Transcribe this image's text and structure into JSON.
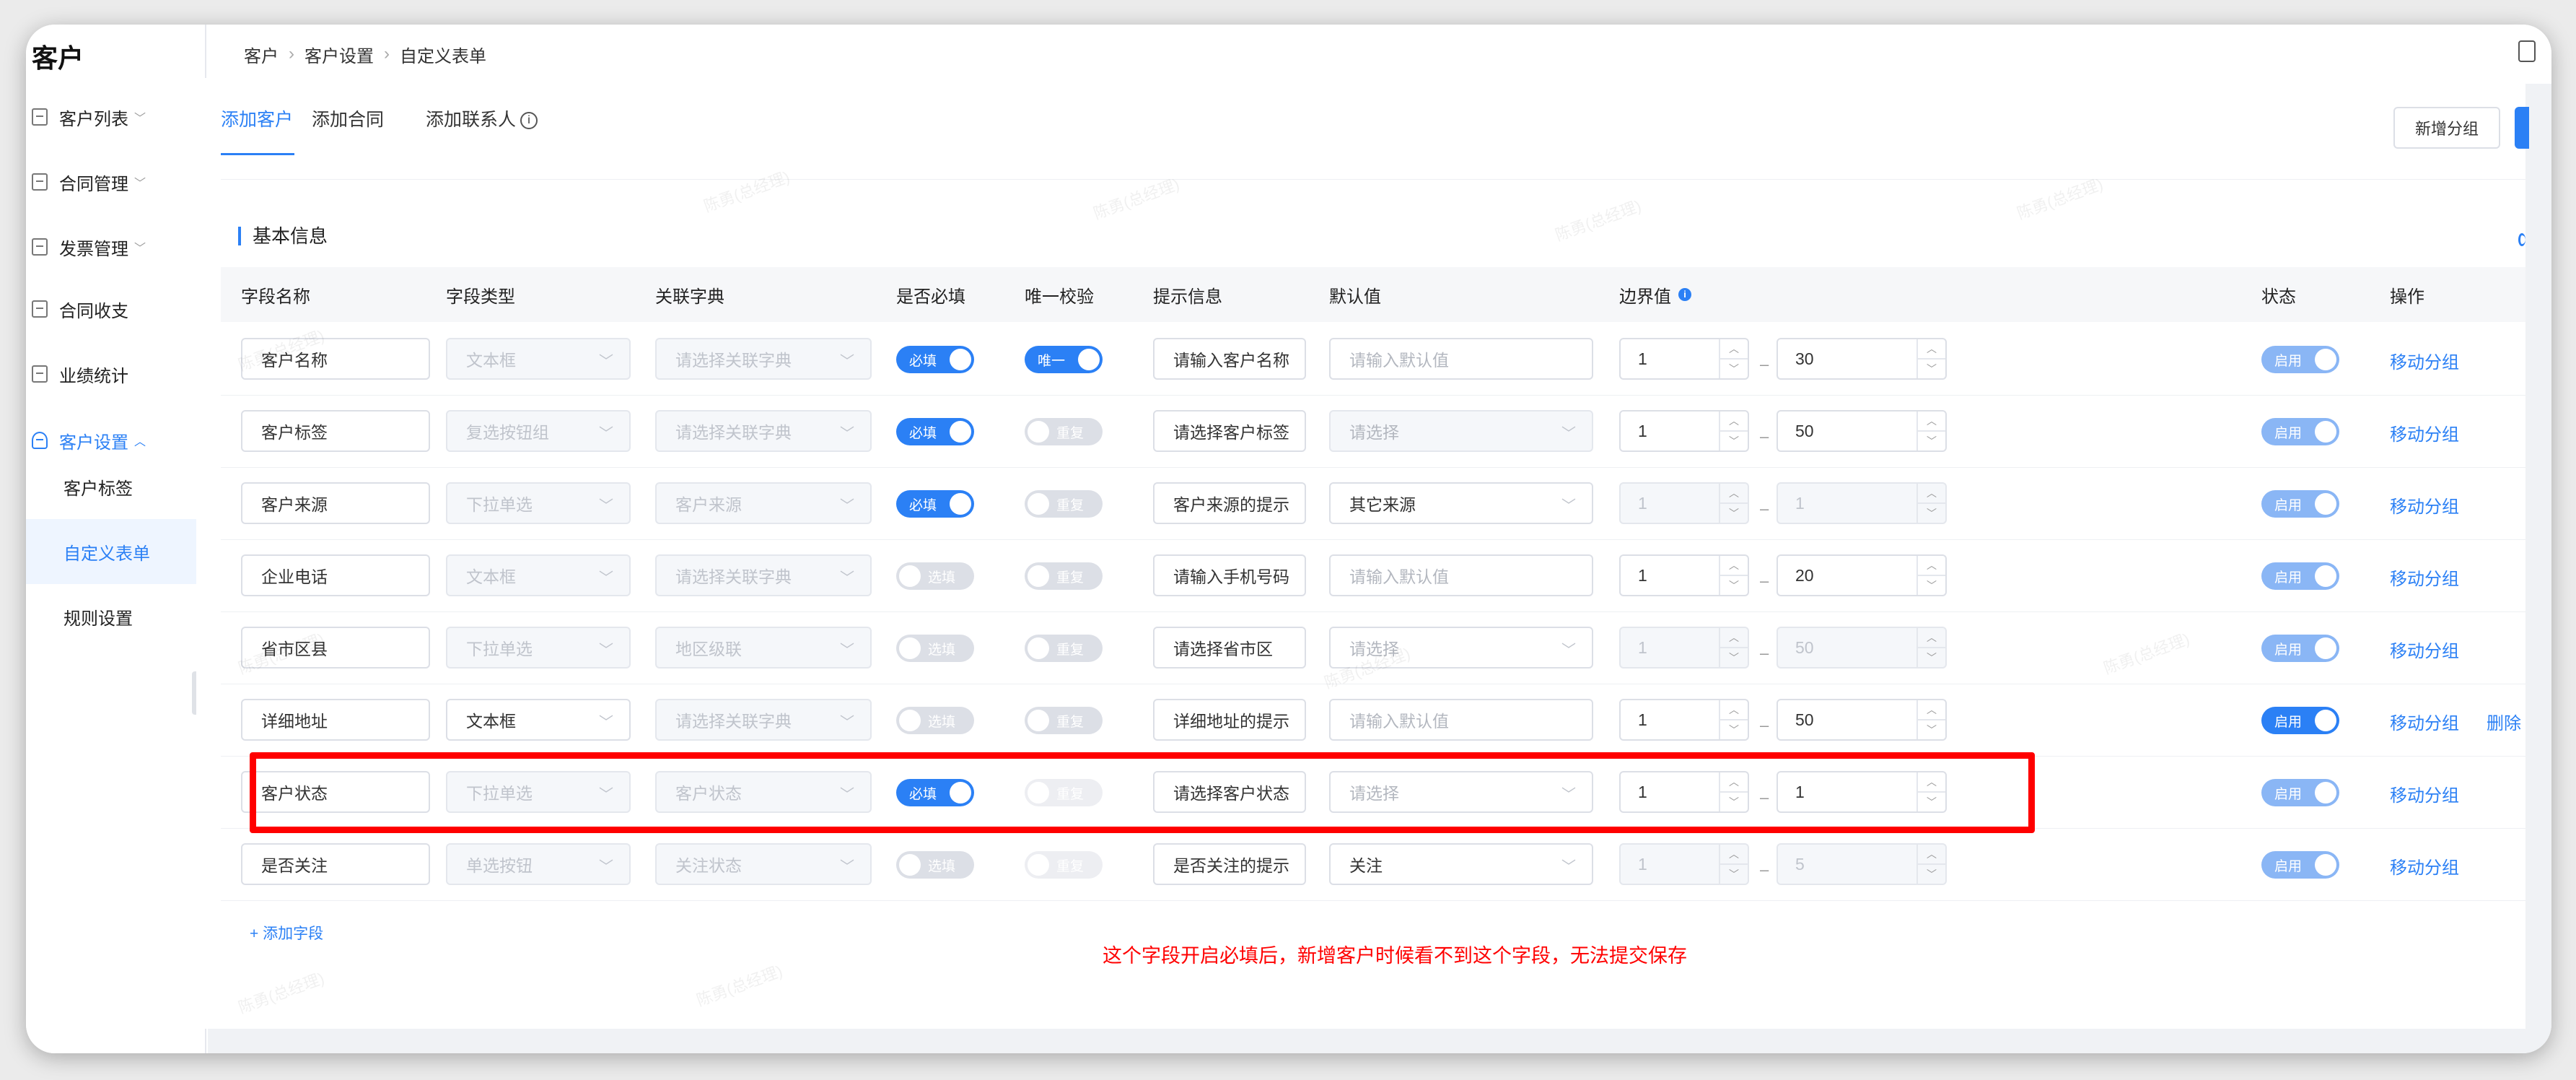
{
  "app_title": "客户",
  "sidebar": {
    "menu": [
      {
        "label": "客户列表",
        "chevron": "﹀"
      },
      {
        "label": "合同管理",
        "chevron": "﹀"
      },
      {
        "label": "发票管理",
        "chevron": "﹀"
      },
      {
        "label": "合同收支",
        "chevron": ""
      },
      {
        "label": "业绩统计",
        "chevron": ""
      },
      {
        "label": "客户设置",
        "chevron": "︿"
      }
    ],
    "submenu": [
      "客户标签",
      "自定义表单",
      "规则设置"
    ],
    "collapse_glyph": "‹"
  },
  "breadcrumb": [
    "客户",
    "客户设置",
    "自定义表单"
  ],
  "breadcrumb_sep": "›",
  "tabs": [
    "添加客户",
    "添加合同",
    "添加联系人"
  ],
  "info_glyph": "i",
  "new_group_button": "新增分组",
  "section_title": "基本信息",
  "columns": [
    "字段名称",
    "字段类型",
    "关联字典",
    "是否必填",
    "唯一校验",
    "提示信息",
    "默认值",
    "边界值",
    "状态",
    "操作"
  ],
  "boundary_tip": "i",
  "rows": [
    {
      "name": "客户名称",
      "type": "文本框",
      "type_disabled": true,
      "dict": "请选择关联字典",
      "dict_placeholder": true,
      "required": "必填",
      "required_on": true,
      "unique": "唯一",
      "unique_on": true,
      "unique_faded": false,
      "hint": "请输入客户名称",
      "default": "请输入默认值",
      "default_kind": "input",
      "default_placeholder": true,
      "min": "1",
      "max": "30",
      "bounds_disabled": false,
      "status": "启用",
      "status_faded": true,
      "move": "移动分组",
      "delete": ""
    },
    {
      "name": "客户标签",
      "type": "复选按钮组",
      "type_disabled": true,
      "dict": "请选择关联字典",
      "dict_placeholder": true,
      "required": "必填",
      "required_on": true,
      "unique": "重复",
      "unique_on": false,
      "unique_faded": false,
      "hint": "请选择客户标签",
      "default": "请选择",
      "default_kind": "select",
      "default_placeholder": true,
      "default_disabled": true,
      "min": "1",
      "max": "50",
      "bounds_disabled": false,
      "status": "启用",
      "status_faded": true,
      "move": "移动分组",
      "delete": ""
    },
    {
      "name": "客户来源",
      "type": "下拉单选",
      "type_disabled": true,
      "dict": "客户来源",
      "dict_placeholder": false,
      "required": "必填",
      "required_on": true,
      "unique": "重复",
      "unique_on": false,
      "unique_faded": false,
      "hint": "客户来源的提示",
      "default": "其它来源",
      "default_kind": "select",
      "default_placeholder": false,
      "min": "1",
      "max": "1",
      "bounds_disabled": true,
      "status": "启用",
      "status_faded": true,
      "move": "移动分组",
      "delete": ""
    },
    {
      "name": "企业电话",
      "type": "文本框",
      "type_disabled": true,
      "dict": "请选择关联字典",
      "dict_placeholder": true,
      "required": "选填",
      "required_on": false,
      "unique": "重复",
      "unique_on": false,
      "unique_faded": false,
      "hint": "请输入手机号码",
      "default": "请输入默认值",
      "default_kind": "input",
      "default_placeholder": true,
      "min": "1",
      "max": "20",
      "bounds_disabled": false,
      "status": "启用",
      "status_faded": true,
      "move": "移动分组",
      "delete": ""
    },
    {
      "name": "省市区县",
      "type": "下拉单选",
      "type_disabled": true,
      "dict": "地区级联",
      "dict_placeholder": false,
      "required": "选填",
      "required_on": false,
      "unique": "重复",
      "unique_on": false,
      "unique_faded": false,
      "hint": "请选择省市区",
      "default": "请选择",
      "default_kind": "select",
      "default_placeholder": true,
      "min": "1",
      "max": "50",
      "bounds_disabled": true,
      "status": "启用",
      "status_faded": true,
      "move": "移动分组",
      "delete": ""
    },
    {
      "name": "详细地址",
      "type": "文本框",
      "type_disabled": false,
      "dict": "请选择关联字典",
      "dict_placeholder": true,
      "required": "选填",
      "required_on": false,
      "unique": "重复",
      "unique_on": false,
      "unique_faded": false,
      "hint": "详细地址的提示",
      "default": "请输入默认值",
      "default_kind": "input",
      "default_placeholder": true,
      "min": "1",
      "max": "50",
      "bounds_disabled": false,
      "status": "启用",
      "status_faded": false,
      "move": "移动分组",
      "delete": "删除"
    },
    {
      "name": "客户状态",
      "type": "下拉单选",
      "type_disabled": true,
      "dict": "客户状态",
      "dict_placeholder": false,
      "required": "必填",
      "required_on": true,
      "unique": "重复",
      "unique_on": false,
      "unique_faded": true,
      "hint": "请选择客户状态",
      "default": "请选择",
      "default_kind": "select",
      "default_placeholder": true,
      "min": "1",
      "max": "1",
      "bounds_disabled": false,
      "status": "启用",
      "status_faded": true,
      "move": "移动分组",
      "delete": ""
    },
    {
      "name": "是否关注",
      "type": "单选按钮",
      "type_disabled": true,
      "dict": "关注状态",
      "dict_placeholder": false,
      "required": "选填",
      "required_on": false,
      "unique": "重复",
      "unique_on": false,
      "unique_faded": true,
      "hint": "是否关注的提示",
      "default": "关注",
      "default_kind": "select",
      "default_placeholder": false,
      "min": "1",
      "max": "5",
      "bounds_disabled": true,
      "status": "启用",
      "status_faded": true,
      "move": "移动分组",
      "delete": ""
    }
  ],
  "add_field": "+ 添加字段",
  "note": "这个字段开启必填后，新增客户时候看不到这个字段，无法提交保存",
  "watermark": "陈勇(总经理)",
  "colors": {
    "primary": "#2b80f5",
    "highlight": "#ff0000"
  }
}
